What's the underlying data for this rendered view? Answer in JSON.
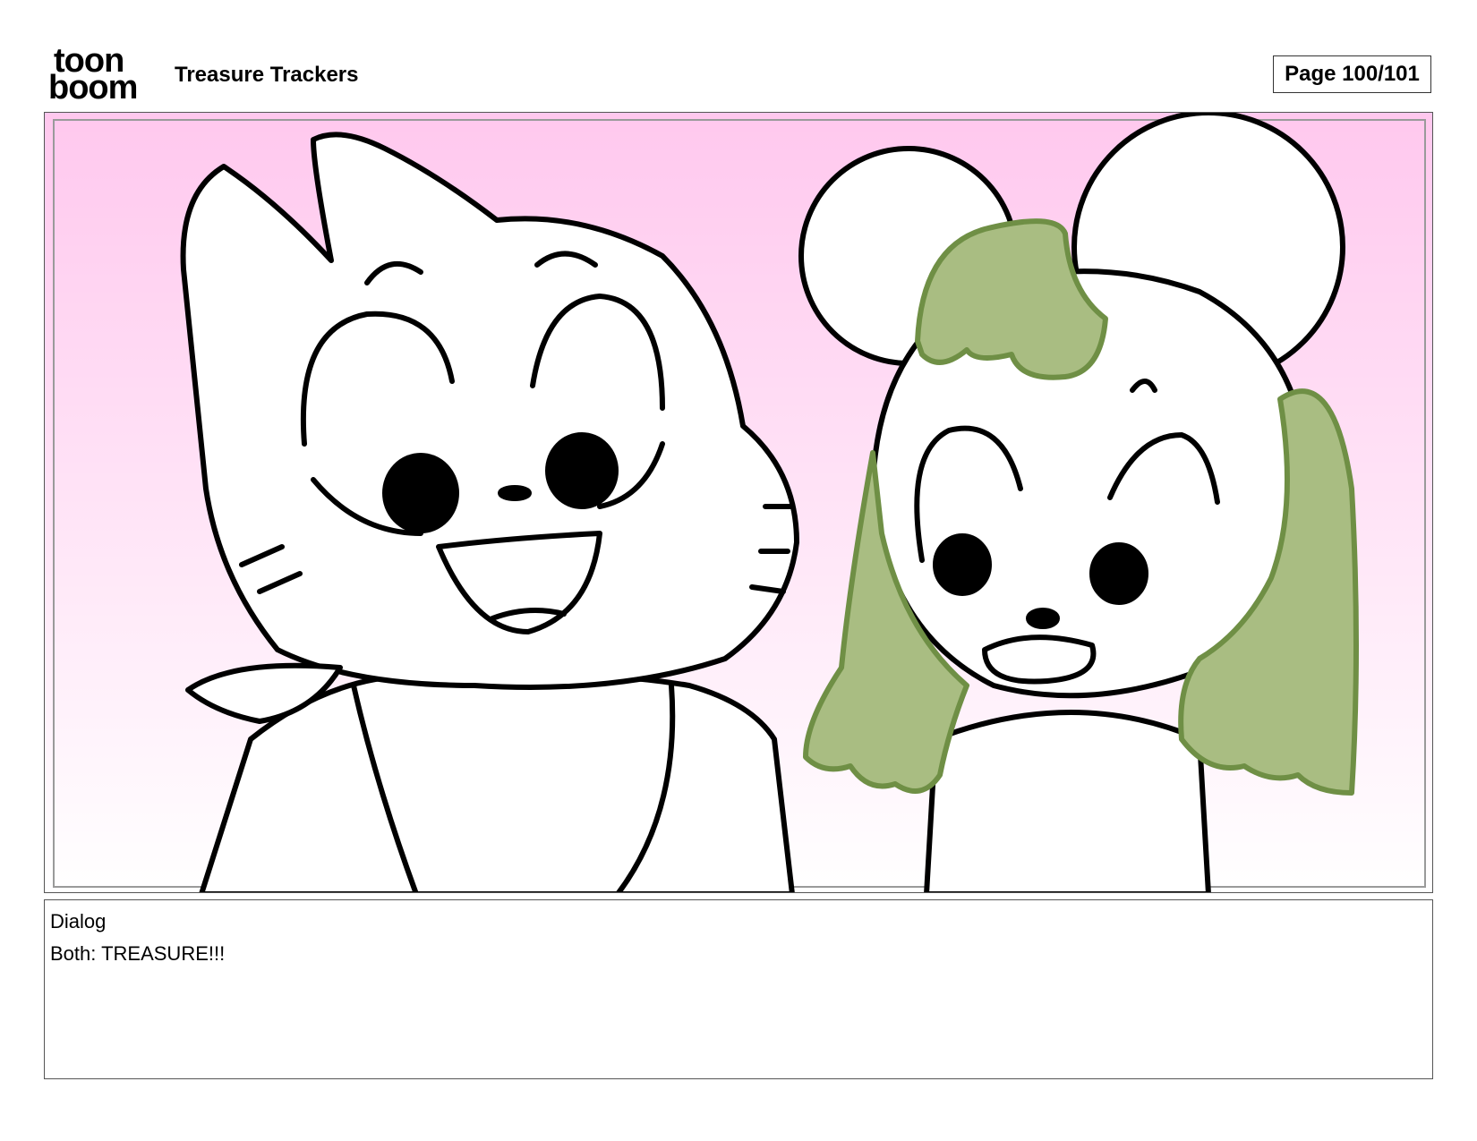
{
  "header": {
    "logo_row1": "toon",
    "logo_row2": "boom",
    "project_title": "Treasure Trackers",
    "page_label": "Page 100/101"
  },
  "panel": {
    "background_top": "#ffc8ee",
    "background_bottom": "#ffffff",
    "hair_color": "#a9bd82",
    "hair_outline": "#6f8f45"
  },
  "dialog": {
    "label": "Dialog",
    "text": "Both: TREASURE!!!"
  }
}
